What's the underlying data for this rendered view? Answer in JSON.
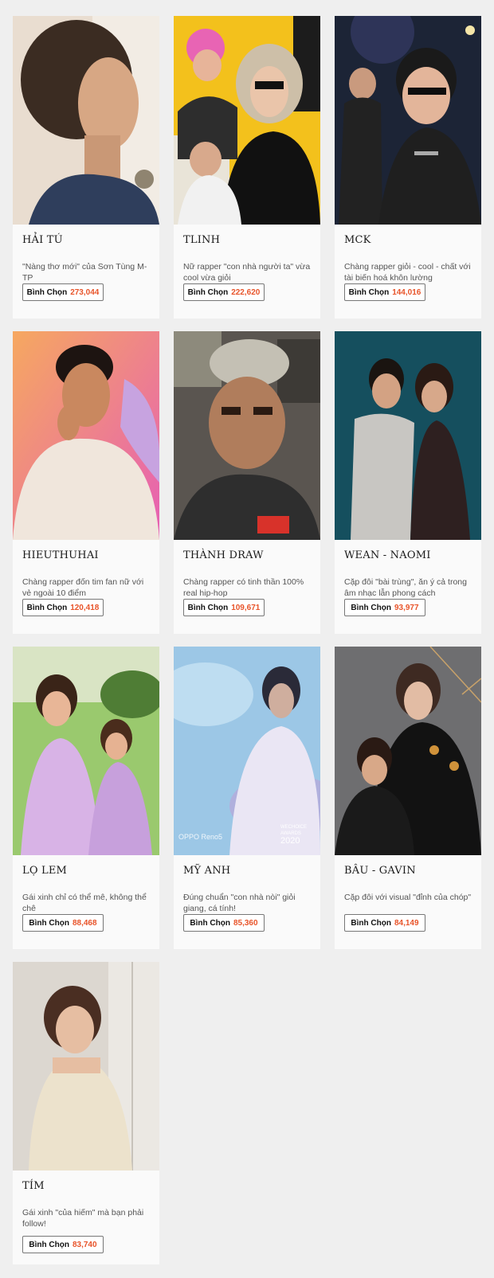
{
  "vote_label": "Bình Chọn",
  "candidates": [
    {
      "name": "HẢI TÚ",
      "desc": "\"Nàng thơ mới\" của Sơn Tùng M-TP",
      "votes": "273,044"
    },
    {
      "name": "TLINH",
      "desc": "Nữ rapper \"con nhà người ta\" vừa cool vừa giỏi",
      "votes": "222,620"
    },
    {
      "name": "MCK",
      "desc": "Chàng rapper giỏi - cool - chất với tài biến hoá khôn lường",
      "votes": "144,016"
    },
    {
      "name": "HIEUTHUHAI",
      "desc": "Chàng rapper đốn tim fan nữ với vẻ ngoài 10 điểm",
      "votes": "120,418"
    },
    {
      "name": "THÀNH DRAW",
      "desc": "Chàng rapper có tinh thần 100% real hip-hop",
      "votes": "109,671"
    },
    {
      "name": "WEAN - NAOMI",
      "desc": "Cặp đôi \"bài trùng\", ăn ý cả trong âm nhạc lẫn phong cách",
      "votes": "93,977"
    },
    {
      "name": "LỌ LEM",
      "desc": "Gái xinh chỉ có thể mê, không thể chê",
      "votes": "88,468"
    },
    {
      "name": "MỸ ANH",
      "desc": "Đúng chuẩn \"con nhà nòi\" giỏi giang, cá tính!",
      "votes": "85,360"
    },
    {
      "name": "BÂU - GAVIN",
      "desc": "Cặp đôi với visual \"đỉnh của chóp\"",
      "votes": "84,149"
    },
    {
      "name": "TÍM",
      "desc": "Gái xinh \"của hiếm\" mà bạn phải follow!",
      "votes": "83,740"
    }
  ],
  "photo_overlays": {
    "oppo": "OPPO Reno5",
    "wechoice_line1": "WECHOICE",
    "wechoice_line2": "AWARDS",
    "wechoice_year": "2020"
  }
}
